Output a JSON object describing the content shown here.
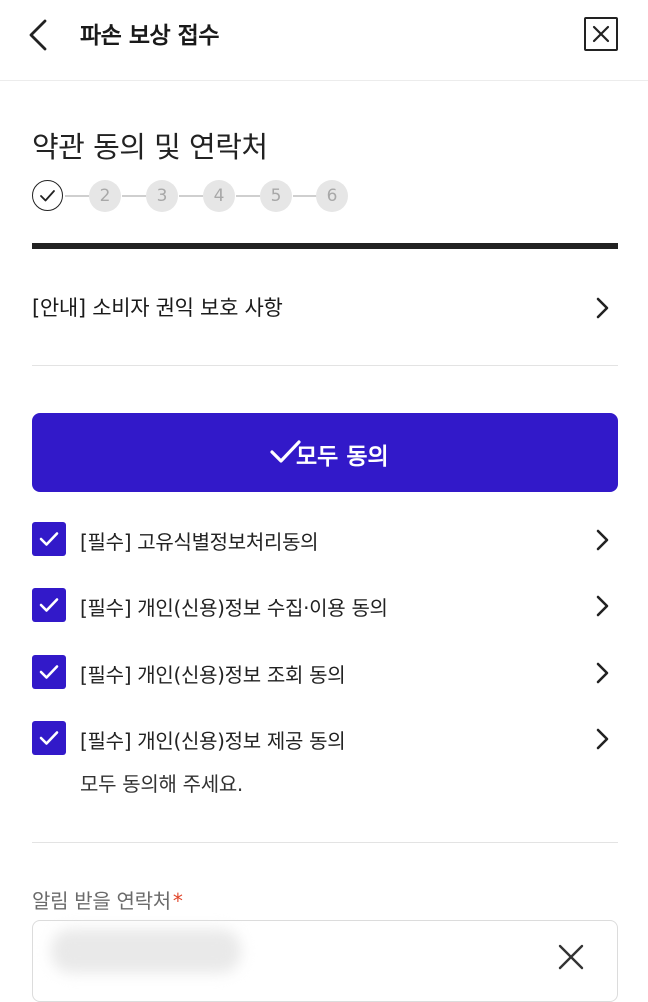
{
  "header": {
    "title": "파손 보상 접수",
    "back_icon": "chevron-left-icon",
    "close_icon": "close-icon"
  },
  "section": {
    "title": "약관 동의 및 연락처"
  },
  "stepper": {
    "current_step": 1,
    "total_steps": 6,
    "steps": [
      "2",
      "3",
      "4",
      "5",
      "6"
    ]
  },
  "notice": {
    "label": "[안내] 소비자 권익 보호 사항"
  },
  "agree_all": {
    "label": "모두 동의"
  },
  "terms": [
    {
      "label": "[필수] 고유식별정보처리동의",
      "checked": true
    },
    {
      "label": "[필수] 개인(신용)정보 수집·이용 동의",
      "checked": true
    },
    {
      "label": "[필수] 개인(신용)정보 조회 동의",
      "checked": true
    },
    {
      "label": "[필수] 개인(신용)정보 제공 동의",
      "checked": true
    }
  ],
  "hint": "모두 동의해 주세요.",
  "contact": {
    "label": "알림 받을 연락처",
    "required_mark": "*"
  },
  "colors": {
    "accent": "#3219c9",
    "required": "#e0452a",
    "step_inactive_bg": "#e6e6e6",
    "step_inactive_text": "#a8a8a8"
  }
}
